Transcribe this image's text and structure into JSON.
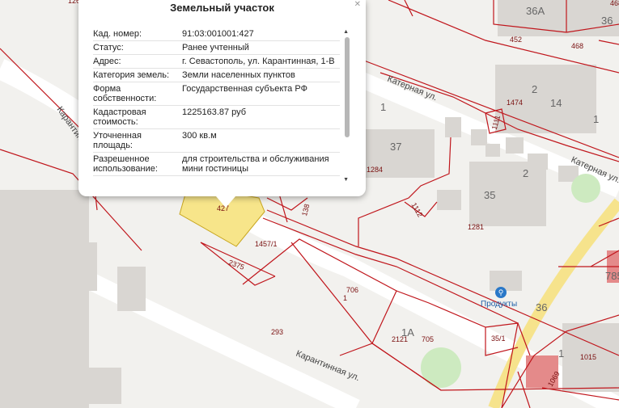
{
  "popup": {
    "title": "Земельный участок",
    "close_icon": "close-icon",
    "rows": [
      {
        "key": "Кад. номер:",
        "value": "91:03:001001:427"
      },
      {
        "key": "Статус:",
        "value": "Ранее учтенный"
      },
      {
        "key": "Адрес:",
        "value": "г. Севастополь, ул. Карантинная, 1-В"
      },
      {
        "key": "Категория земель:",
        "value": "Земли населенных пунктов"
      },
      {
        "key": "Форма собственности:",
        "value": "Государственная субъекта РФ"
      },
      {
        "key": "Кадастровая стоимость:",
        "value": "1225163.87 руб"
      },
      {
        "key": "Уточненная площадь:",
        "value": "300 кв.м"
      },
      {
        "key": "Разрешенное использование:",
        "value": "для строительства и обслуживания мини гостиницы"
      }
    ]
  },
  "map": {
    "streets": [
      "Катерная ул.",
      "Катерная ул.",
      "Карантинная ул.",
      "Карантинн"
    ],
    "building_numbers": [
      "36А",
      "36",
      "14",
      "37",
      "35",
      "1А",
      "1",
      "36",
      "1",
      "1",
      "2",
      "2",
      "785"
    ],
    "parcel_numbers": [
      "468",
      "452",
      "468",
      "1474",
      "1111",
      "1284",
      "1112",
      "1281",
      "1457/1",
      "2375",
      "706",
      "293",
      "2121",
      "705",
      "35/1",
      "1015",
      "1069",
      "427",
      "138",
      "1",
      "126"
    ],
    "poi": {
      "label": "Продукты",
      "icon": "shop-icon"
    },
    "selected_parcel_color": "#f7e58a",
    "parcel_line_color": "#c0161c"
  }
}
